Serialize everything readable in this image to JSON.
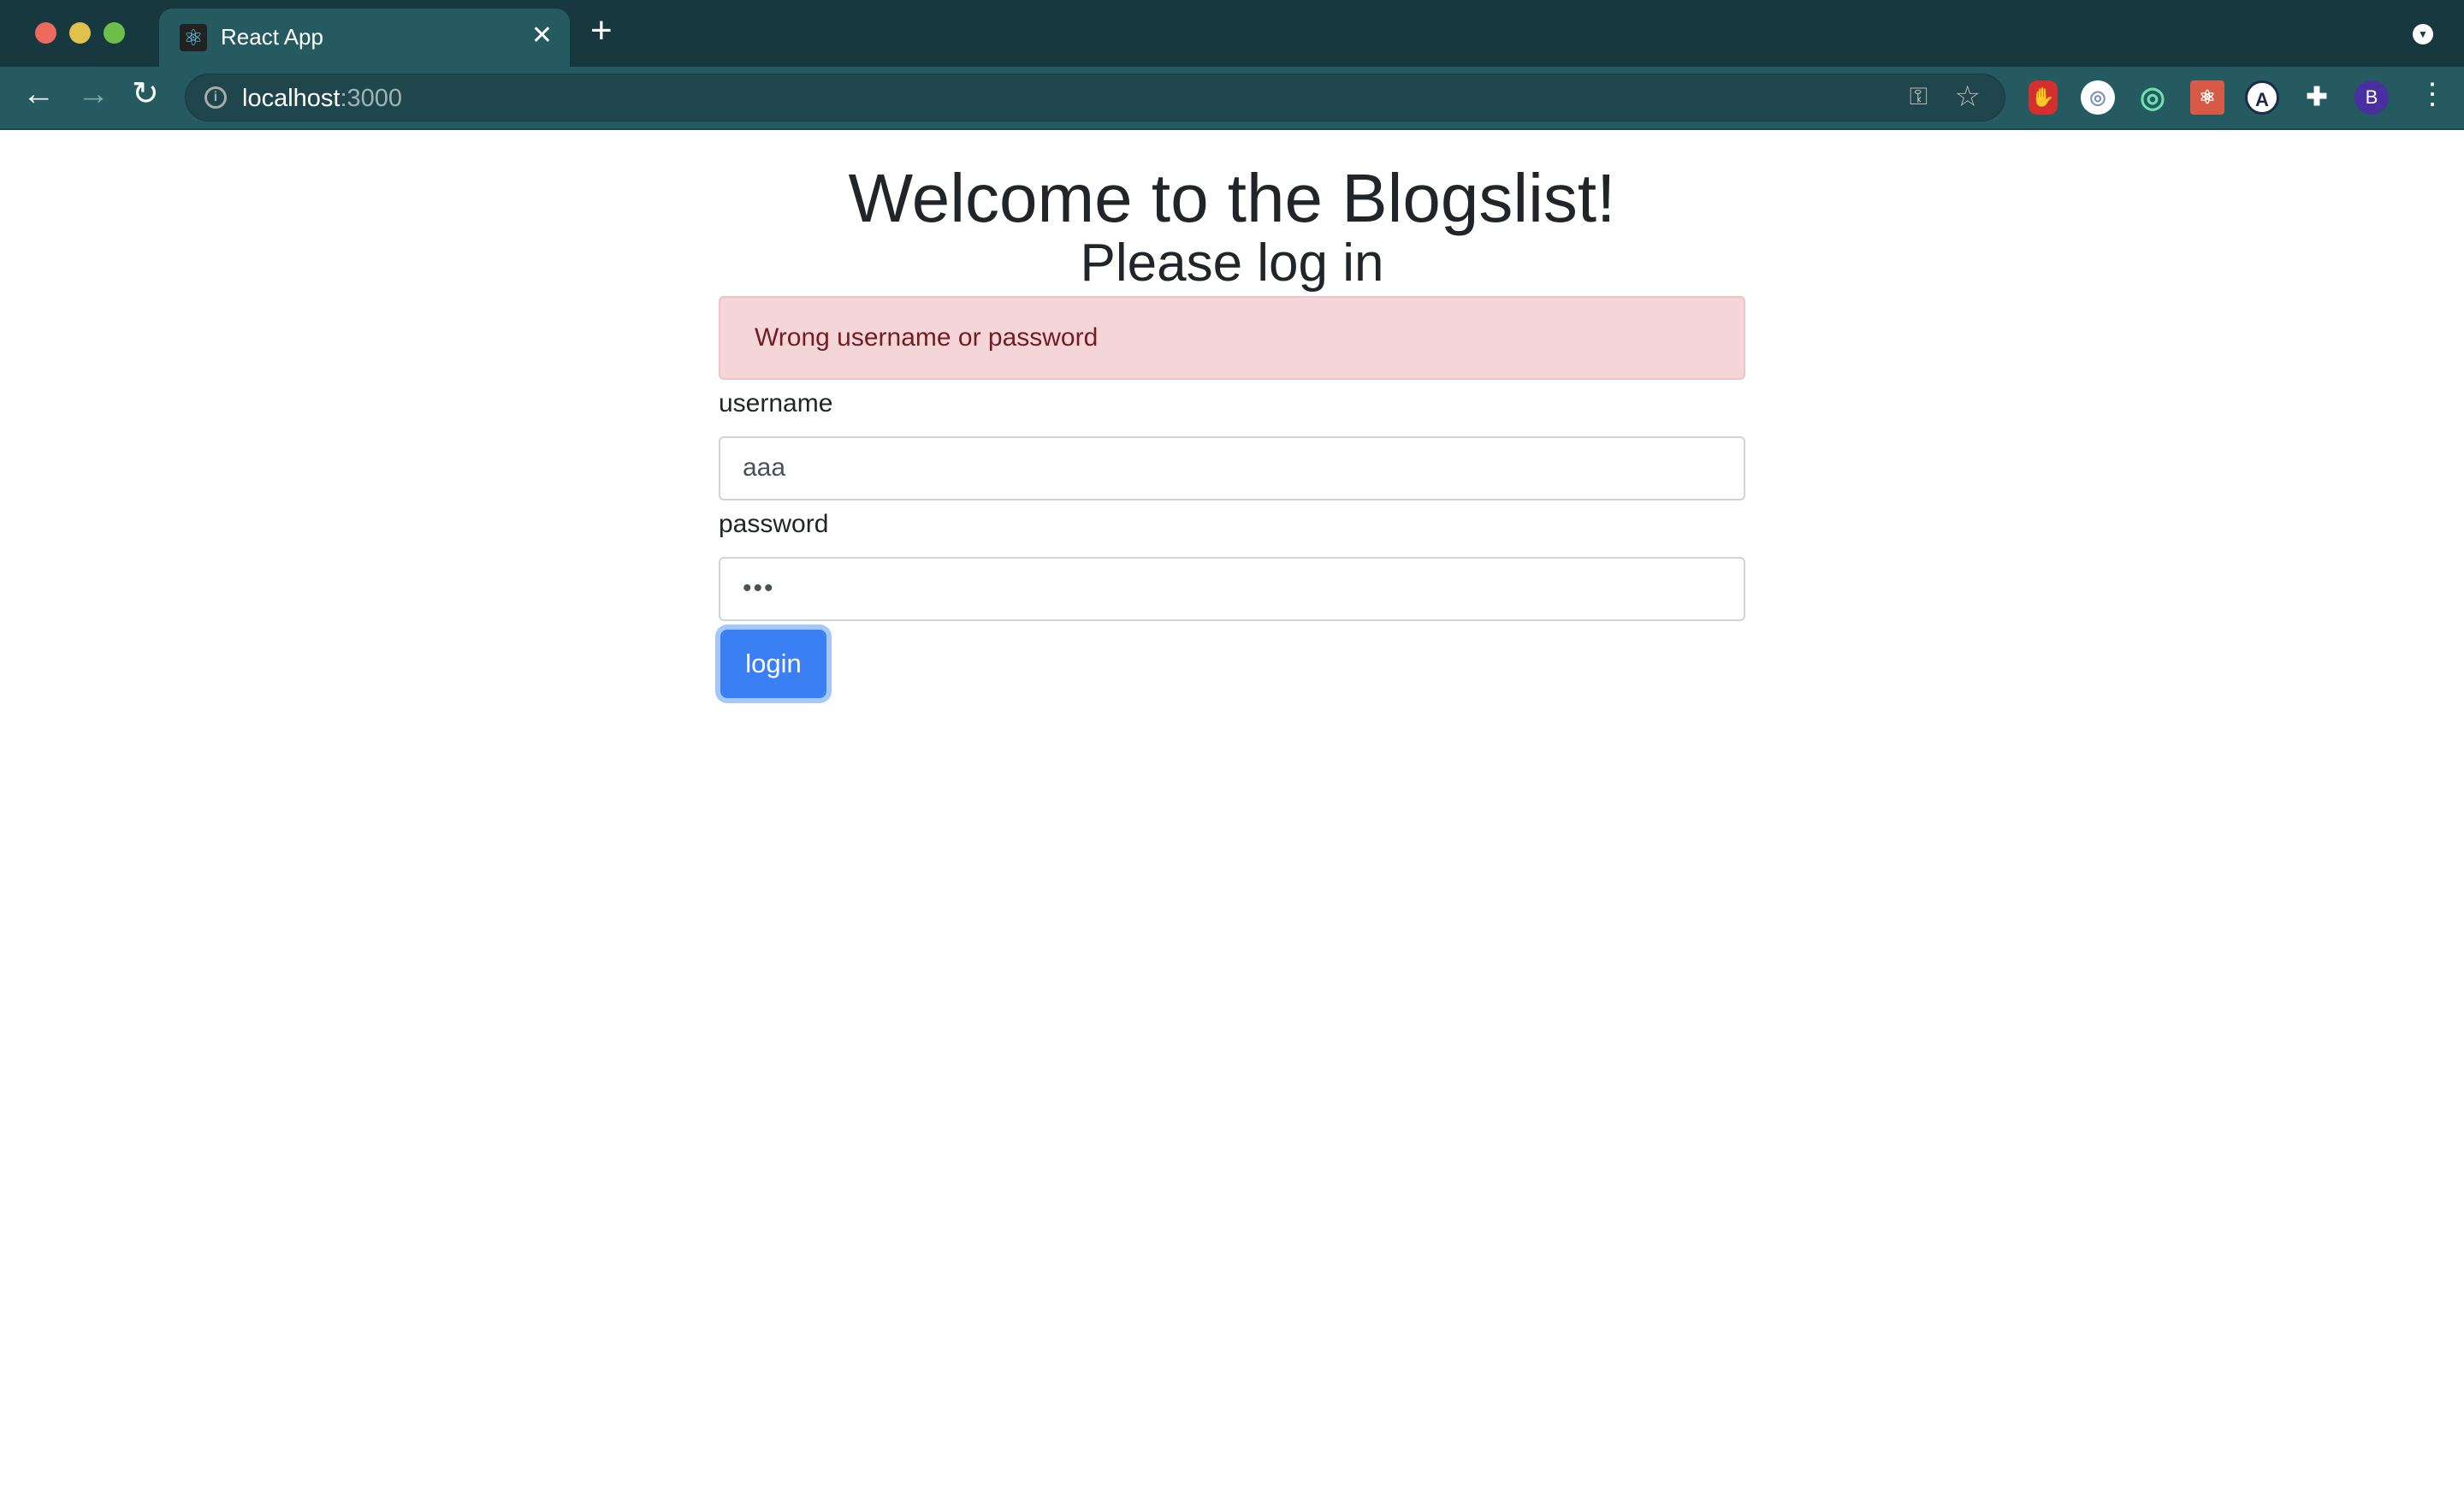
{
  "browser": {
    "tab_title": "React App",
    "url_host": "localhost",
    "url_port": ":3000",
    "profile_initial": "B",
    "extensions": [
      "adblock-icon",
      "json-viewer-icon",
      "orbit-icon",
      "react-devtools-icon",
      "a-ext-icon",
      "puzzle-icon"
    ]
  },
  "page": {
    "title": "Welcome to the Blogslist!",
    "subtitle": "Please log in",
    "error": "Wrong username or password",
    "username_label": "username",
    "username_value": "aaa",
    "password_label": "password",
    "password_value": "•••",
    "login_label": "login"
  },
  "colors": {
    "alert_bg": "#f4d6d9",
    "alert_text": "#721c24",
    "button": "#3b7ff5",
    "chrome": "#255a61"
  }
}
